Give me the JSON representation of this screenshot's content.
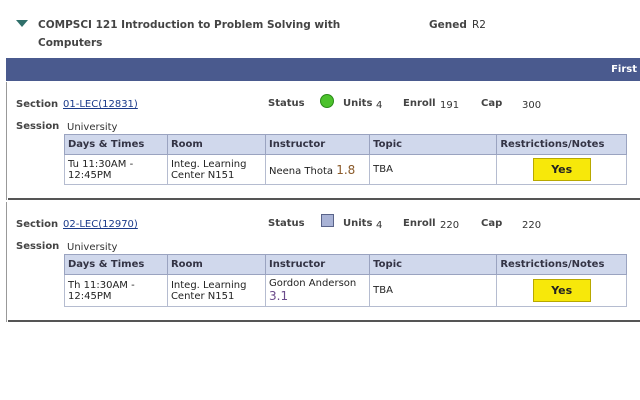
{
  "course": {
    "title": "COMPSCI 121 Introduction to Problem Solving with Computers",
    "gened_label": "Gened",
    "gened_value": "R2"
  },
  "nav": {
    "first": "First"
  },
  "labels": {
    "section": "Section",
    "status": "Status",
    "units": "Units",
    "enroll": "Enroll",
    "cap": "Cap",
    "session": "Session"
  },
  "table_headers": [
    "Days & Times",
    "Room",
    "Instructor",
    "Topic",
    "Restrictions/Notes"
  ],
  "sections": [
    {
      "id": "01-LEC(12831)",
      "status": "open",
      "units": "4",
      "enroll": "191",
      "cap": "300",
      "session": "University",
      "days_times": "Tu 11:30AM - 12:45PM",
      "room": "Integ. Learning Center N151",
      "instructor": "Neena Thota",
      "rating": "1.8",
      "topic": "TBA",
      "notes_button": "Yes"
    },
    {
      "id": "02-LEC(12970)",
      "status": "closed",
      "units": "4",
      "enroll": "220",
      "cap": "220",
      "session": "University",
      "days_times": "Th 11:30AM - 12:45PM",
      "room": "Integ. Learning Center N151",
      "instructor": "Gordon Anderson",
      "rating": "3.1",
      "topic": "TBA",
      "notes_button": "Yes"
    }
  ],
  "colors": {
    "nav_bar": "#4a5a8e",
    "open_status": "#4cc22c",
    "closed_status": "#a9b3d6",
    "yes_button": "#f7e80a",
    "table_header": "#d0d8ec"
  },
  "icons": {
    "expand": "triangle-down-icon",
    "status_open": "green-circle-icon",
    "status_closed": "closed-square-icon"
  }
}
